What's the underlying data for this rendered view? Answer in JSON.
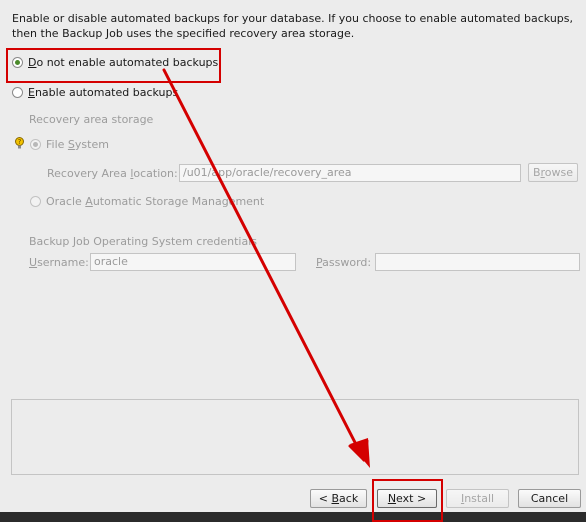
{
  "description": "Enable or disable automated backups for your database. If you choose to enable automated backups, then the Backup Job uses the specified recovery area storage.",
  "options": {
    "disable": {
      "label": "Do not enable automated backups",
      "mnemonic": "D",
      "rest": "o not enable automated backups",
      "selected": true
    },
    "enable": {
      "label": "Enable automated backups",
      "mnemonic": "E",
      "rest": "nable automated backups",
      "selected": false
    }
  },
  "recovery": {
    "heading": "Recovery area storage",
    "file_system": {
      "pre": "File ",
      "mnemonic": "S",
      "post": "ystem",
      "selected": true
    },
    "location": {
      "pre": "Recovery Area ",
      "mnemonic": "l",
      "post": "ocation:",
      "value": "/u01/app/oracle/recovery_area"
    },
    "browse": {
      "pre": "B",
      "mnemonic": "r",
      "post": "owse"
    },
    "asm": {
      "pre": "Oracle ",
      "mnemonic": "A",
      "post": "utomatic Storage Management",
      "selected": false
    }
  },
  "credentials": {
    "heading": "Backup Job Operating System credentials",
    "username": {
      "mnemonic": "U",
      "post": "sername:",
      "value": "oracle"
    },
    "password": {
      "mnemonic": "P",
      "post": "assword:",
      "value": ""
    }
  },
  "buttons": {
    "back": {
      "pre": "< ",
      "mnemonic": "B",
      "post": "ack"
    },
    "next": {
      "mnemonic": "N",
      "post": "ext >"
    },
    "install": {
      "mnemonic": "I",
      "post": "nstall"
    },
    "cancel": {
      "label": "Cancel"
    }
  },
  "colors": {
    "annotation_red": "#d40000",
    "radio_selected": "#4a8a2a"
  },
  "icons": {
    "hint": "hint-lightbulb-icon",
    "arrow": "annotation-arrow"
  }
}
